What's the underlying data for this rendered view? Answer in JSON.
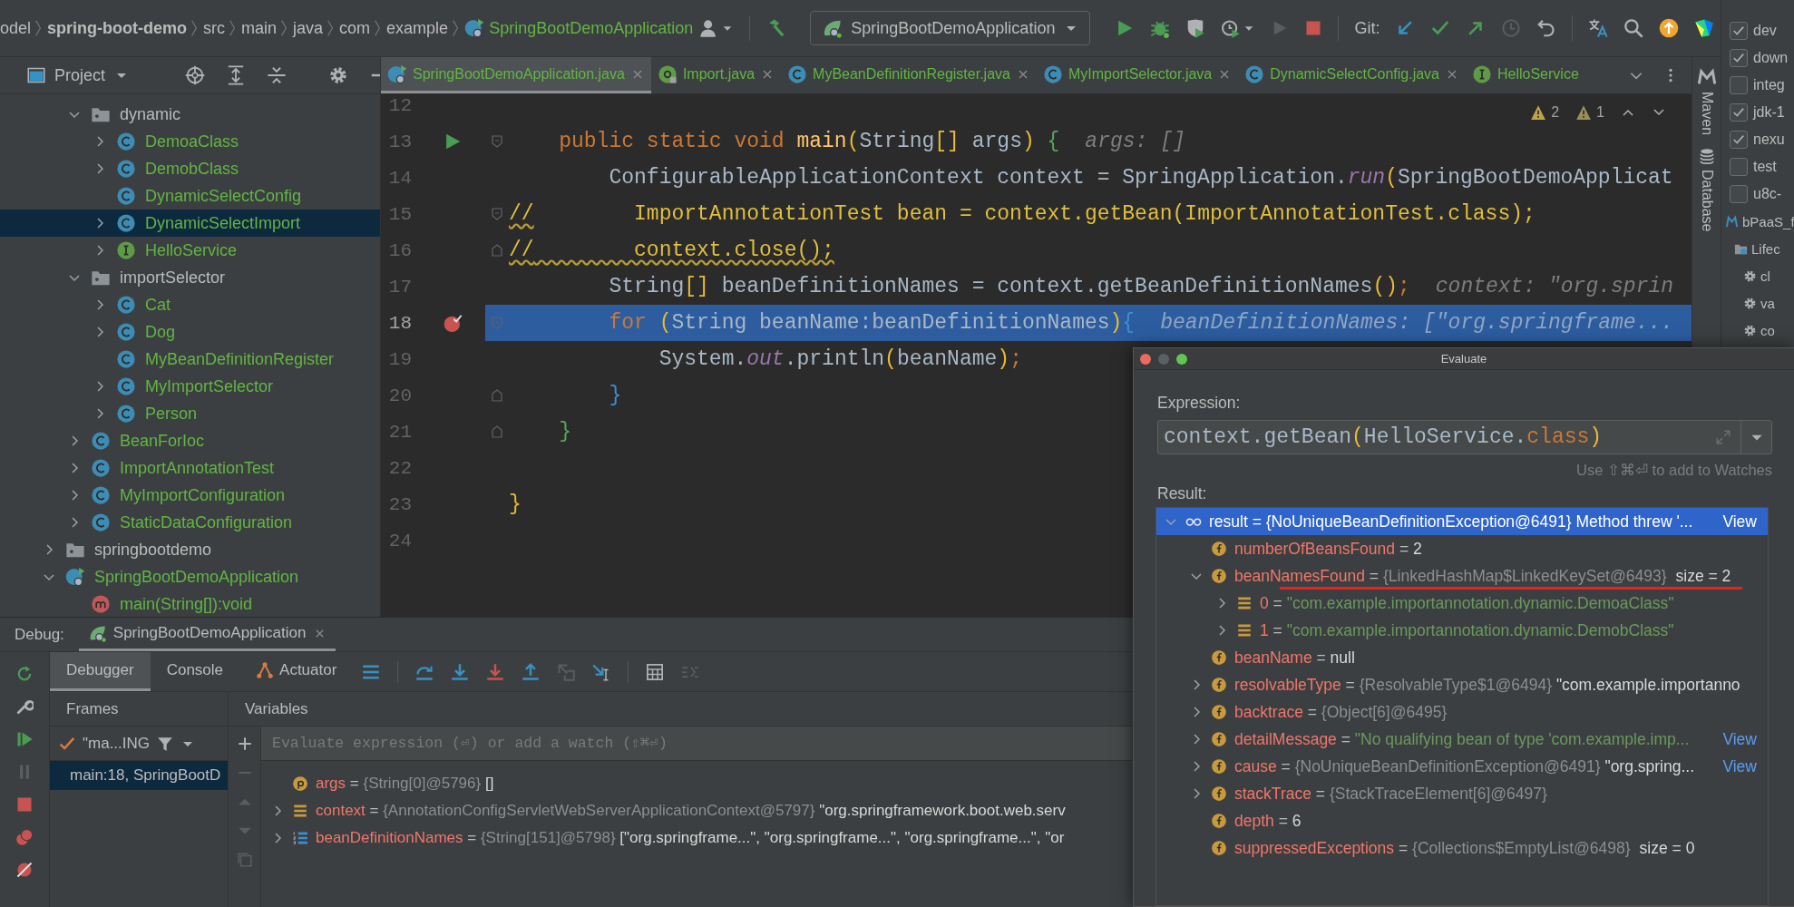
{
  "breadcrumbs": [
    {
      "label": "odel",
      "kind": "module"
    },
    {
      "label": "spring-boot-demo",
      "kind": "project"
    },
    {
      "label": "src",
      "kind": "dir"
    },
    {
      "label": "main",
      "kind": "dir"
    },
    {
      "label": "java",
      "kind": "dir"
    },
    {
      "label": "com",
      "kind": "dir"
    },
    {
      "label": "example",
      "kind": "dir"
    },
    {
      "label": "SpringBootDemoApplication",
      "kind": "class"
    }
  ],
  "toolbar": {
    "run_config": "SpringBootDemoApplication",
    "git_label": "Git:"
  },
  "project": {
    "title": "Project",
    "tree": [
      {
        "children": [
          {
            "label": "dynamic",
            "kind": "folder",
            "expanded": true,
            "selected": false,
            "children": [
              {
                "label": "DemoaClass",
                "kind": "class",
                "expanded": false,
                "selected": false
              },
              {
                "label": "DemobClass",
                "kind": "class",
                "expanded": false,
                "selected": false
              },
              {
                "label": "DynamicSelectConfig",
                "kind": "class",
                "selected": false
              },
              {
                "label": "DynamicSelectImport",
                "kind": "class",
                "expanded": false,
                "selected": true
              },
              {
                "label": "HelloService",
                "kind": "interface",
                "expanded": false,
                "selected": false
              }
            ]
          },
          {
            "label": "importSelector",
            "kind": "folder",
            "expanded": true,
            "selected": false,
            "children": [
              {
                "label": "Cat",
                "kind": "class",
                "expanded": false,
                "selected": false
              },
              {
                "label": "Dog",
                "kind": "class",
                "expanded": false,
                "selected": false
              },
              {
                "label": "MyBeanDefinitionRegister",
                "kind": "class",
                "selected": false
              },
              {
                "label": "MyImportSelector",
                "kind": "class",
                "expanded": false,
                "selected": false
              },
              {
                "label": "Person",
                "kind": "class",
                "expanded": false,
                "selected": false
              }
            ]
          },
          {
            "label": "BeanForIoc",
            "kind": "class",
            "expanded": false,
            "selected": false
          },
          {
            "label": "ImportAnnotationTest",
            "kind": "class",
            "expanded": false,
            "selected": false
          },
          {
            "label": "MyImportConfiguration",
            "kind": "class",
            "expanded": false,
            "selected": false
          },
          {
            "label": "StaticDataConfiguration",
            "kind": "class",
            "expanded": false,
            "selected": false
          }
        ]
      },
      {
        "label": "springbootdemo",
        "kind": "folder",
        "expanded": false,
        "selected": false
      },
      {
        "label": "SpringBootDemoApplication",
        "kind": "app",
        "expanded": true,
        "selected": false,
        "children": [
          {
            "label": "main(String[]):void",
            "kind": "method",
            "selected": false
          }
        ]
      }
    ]
  },
  "editor": {
    "tabs": [
      {
        "label": "SpringBootDemoApplication.java",
        "kind": "app",
        "selected": true
      },
      {
        "label": "Import.java",
        "kind": "annotation",
        "selected": false
      },
      {
        "label": "MyBeanDefinitionRegister.java",
        "kind": "class",
        "selected": false
      },
      {
        "label": "MyImportSelector.java",
        "kind": "class",
        "selected": false
      },
      {
        "label": "DynamicSelectConfig.java",
        "kind": "class",
        "selected": false
      },
      {
        "label": "HelloService",
        "kind": "interface",
        "selected": false
      }
    ],
    "problems": {
      "warnings": "2",
      "weak_warnings": "1"
    },
    "lines": [
      {
        "number": "12",
        "selected": false
      },
      {
        "number": "13",
        "selected": false,
        "runnable": true,
        "fold_start": true,
        "tokens": [
          {
            "t": "    public static void ",
            "kind": "kw"
          },
          {
            "t": "main",
            "kind": "fn"
          },
          {
            "t": "(",
            "kind": "b1"
          },
          {
            "t": "String",
            "kind": "plain"
          },
          {
            "t": "[]",
            "kind": "b1"
          },
          {
            "t": " args",
            "kind": "plain"
          },
          {
            "t": ") ",
            "kind": "b1"
          },
          {
            "t": "{",
            "kind": "b2"
          },
          {
            "t": "args: []",
            "kind": "hint"
          }
        ]
      },
      {
        "number": "14",
        "selected": false,
        "tokens": [
          {
            "t": "        ConfigurableApplicationContext context = SpringApplication.",
            "kind": "plain"
          },
          {
            "t": "run",
            "kind": "static"
          },
          {
            "t": "(",
            "kind": "b1"
          },
          {
            "t": "SpringBootDemoApplicat",
            "kind": "plain"
          }
        ]
      },
      {
        "number": "15",
        "selected": false,
        "fold_start": true,
        "tokens": [
          {
            "t": "//",
            "kind": "commented",
            "wavy": true
          },
          {
            "t": "        ImportAnnotationTest bean = context.getBean(ImportAnnotationTest.class);",
            "kind": "commented"
          }
        ]
      },
      {
        "number": "16",
        "selected": false,
        "fold_end": true,
        "tokens": [
          {
            "t": "//",
            "kind": "commented",
            "wavy": true
          },
          {
            "t": "        context.close();",
            "kind": "commented",
            "wavy": true
          }
        ]
      },
      {
        "number": "17",
        "selected": false,
        "tokens": [
          {
            "t": "        String",
            "kind": "plain"
          },
          {
            "t": "[]",
            "kind": "b1"
          },
          {
            "t": " beanDefinitionNames = context.getBeanDefinitionNames",
            "kind": "plain"
          },
          {
            "t": "()",
            "kind": "b1"
          },
          {
            "t": ";",
            "kind": "kw"
          },
          {
            "t": "context: \"org.sprin",
            "kind": "hint"
          }
        ]
      },
      {
        "number": "18",
        "selected": true,
        "breakpoint": true,
        "fold_start": true,
        "tokens": [
          {
            "t": "        for ",
            "kind": "kw"
          },
          {
            "t": "(",
            "kind": "b1"
          },
          {
            "t": "String beanName:beanDefinitionNames",
            "kind": "plain"
          },
          {
            "t": ")",
            "kind": "b1"
          },
          {
            "t": "{",
            "kind": "b3"
          },
          {
            "t": "beanDefinitionNames: [\"org.springframe...",
            "kind": "hint"
          }
        ]
      },
      {
        "number": "19",
        "selected": false,
        "tokens": [
          {
            "t": "            System.",
            "kind": "plain"
          },
          {
            "t": "out",
            "kind": "static"
          },
          {
            "t": ".println",
            "kind": "plain"
          },
          {
            "t": "(",
            "kind": "b1"
          },
          {
            "t": "beanName",
            "kind": "plain"
          },
          {
            "t": ")",
            "kind": "b1"
          },
          {
            "t": ";",
            "kind": "kw"
          }
        ]
      },
      {
        "number": "20",
        "selected": false,
        "fold_end": true,
        "tokens": [
          {
            "t": "        }",
            "kind": "b3"
          }
        ]
      },
      {
        "number": "21",
        "selected": false,
        "fold_end": true,
        "tokens": [
          {
            "t": "    }",
            "kind": "b2"
          }
        ]
      },
      {
        "number": "22",
        "selected": false
      },
      {
        "number": "23",
        "selected": false,
        "tokens": [
          {
            "t": "}",
            "kind": "b1"
          }
        ]
      },
      {
        "number": "24",
        "selected": false
      }
    ]
  },
  "side_tools": {
    "maven": "Maven",
    "database": "Database"
  },
  "maven": {
    "profiles": [
      {
        "label": "dev",
        "checked": true
      },
      {
        "label": "down",
        "checked": true
      },
      {
        "label": "integ",
        "checked": false
      },
      {
        "label": "jdk-1",
        "checked": true
      },
      {
        "label": "nexu",
        "checked": true
      },
      {
        "label": "test",
        "checked": false
      },
      {
        "label": "u8c-",
        "checked": false
      }
    ],
    "tree": [
      {
        "label": "bPaaS_f",
        "kind": "project",
        "children": [
          {
            "label": "Lifec",
            "kind": "lifecycle",
            "children": [
              {
                "label": "cl",
                "kind": "goal"
              },
              {
                "label": "va",
                "kind": "goal"
              },
              {
                "label": "co",
                "kind": "goal"
              }
            ]
          }
        ]
      }
    ]
  },
  "debug": {
    "label": "Debug:",
    "session": "SpringBootDemoApplication",
    "tabs": [
      {
        "label": "Debugger",
        "kind": "plain",
        "selected": true
      },
      {
        "label": "Console",
        "kind": "plain",
        "selected": false
      },
      {
        "label": "Actuator",
        "kind": "actuator",
        "selected": false
      }
    ],
    "frames_title": "Frames",
    "variables_title": "Variables",
    "thread": "\"ma...ING",
    "frames": [
      {
        "label": "main:18, SpringBootD",
        "selected": true
      }
    ],
    "watch_placeholder": "Evaluate expression (⏎) or add a watch (⇧⌘⏎)",
    "variables": [
      {
        "kind": "param",
        "name": "args",
        "sep": "=",
        "type": "{String[0]@5796}",
        "value": "[]",
        "is_string": false
      },
      {
        "kind": "object",
        "name": "context",
        "sep": "=",
        "type": "{AnnotationConfigServletWebServerApplicationContext@5797}",
        "value": "\"org.springframework.boot.web.serv",
        "is_string": false,
        "expanded": false
      },
      {
        "kind": "array",
        "name": "beanDefinitionNames",
        "sep": "=",
        "type": "{String[151]@5798}",
        "value": "[\"org.springframe...\", \"org.springframe...\", \"org.springframe...\", \"or",
        "is_string": false,
        "expanded": false
      }
    ]
  },
  "evaluate": {
    "title": "Evaluate",
    "expression_label": "Expression:",
    "expression": [
      {
        "t": "context.getBean",
        "kind": "plain"
      },
      {
        "t": "(",
        "kind": "b1"
      },
      {
        "t": "HelloService.",
        "kind": "plain"
      },
      {
        "t": "class",
        "kind": "kw"
      },
      {
        "t": ")",
        "kind": "b1"
      }
    ],
    "hint": "Use ⇧⌘⏎ to add to Watches",
    "result_label": "Result:",
    "result": [
      {
        "kind": "watch",
        "name": "result",
        "sep": "=",
        "type": "{NoUniqueBeanDefinitionException@6491}",
        "value": "Method threw '...",
        "is_string": false,
        "link": "View",
        "expanded": true,
        "selected": true,
        "underlined": false,
        "children": [
          {
            "kind": "field",
            "name": "numberOfBeansFound",
            "sep": "=",
            "value": "2",
            "is_string": false,
            "selected": false,
            "underlined": false
          },
          {
            "kind": "field",
            "name": "beanNamesFound",
            "sep": "=",
            "type": "{LinkedHashMap$LinkedKeySet@6493}",
            "extra": "size = 2",
            "expanded": true,
            "selected": false,
            "underlined": true,
            "children": [
              {
                "kind": "element",
                "name": "0",
                "sep": "=",
                "value": "\"com.example.importannotation.dynamic.DemoaClass\"",
                "is_string": true,
                "expanded": false,
                "selected": false,
                "underlined": false
              },
              {
                "kind": "element",
                "name": "1",
                "sep": "=",
                "value": "\"com.example.importannotation.dynamic.DemobClass\"",
                "is_string": true,
                "expanded": false,
                "selected": false,
                "underlined": false
              }
            ]
          },
          {
            "kind": "field",
            "name": "beanName",
            "sep": "=",
            "value": "null",
            "is_string": false,
            "selected": false,
            "underlined": false
          },
          {
            "kind": "field",
            "name": "resolvableType",
            "sep": "=",
            "type": "{ResolvableType$1@6494}",
            "value": "\"com.example.importanno",
            "is_string": false,
            "expanded": false,
            "selected": false,
            "underlined": false
          },
          {
            "kind": "field",
            "name": "backtrace",
            "sep": "=",
            "type": "{Object[6]@6495}",
            "expanded": false,
            "selected": false,
            "underlined": false
          },
          {
            "kind": "field",
            "name": "detailMessage",
            "sep": "=",
            "value": "\"No qualifying bean of type 'com.example.imp...",
            "is_string": true,
            "link": "View",
            "expanded": false,
            "selected": false,
            "underlined": false
          },
          {
            "kind": "field",
            "name": "cause",
            "sep": "=",
            "type": "{NoUniqueBeanDefinitionException@6491}",
            "value": "\"org.spring...",
            "is_string": false,
            "link": "View",
            "expanded": false,
            "selected": false,
            "underlined": false
          },
          {
            "kind": "field",
            "name": "stackTrace",
            "sep": "=",
            "type": "{StackTraceElement[6]@6497}",
            "expanded": false,
            "selected": false,
            "underlined": false
          },
          {
            "kind": "field",
            "name": "depth",
            "sep": "=",
            "value": "6",
            "is_string": false,
            "selected": false,
            "underlined": false
          },
          {
            "kind": "field",
            "name": "suppressedExceptions",
            "sep": "=",
            "type": "{Collections$EmptyList@6498}",
            "extra": "size = 0",
            "selected": false,
            "underlined": false
          }
        ]
      }
    ]
  }
}
